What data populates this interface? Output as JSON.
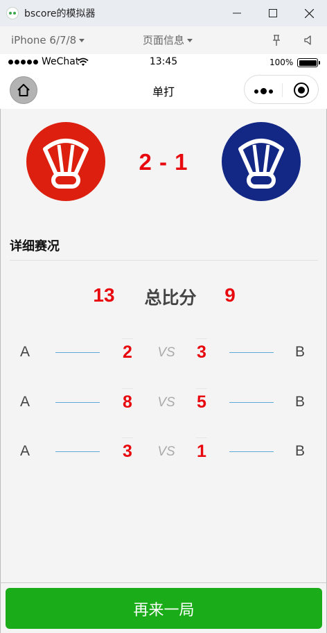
{
  "window": {
    "title": "bscore的模拟器"
  },
  "simulator": {
    "device": "iPhone 6/7/8",
    "page_info": "页面信息"
  },
  "status": {
    "carrier": "WeChat",
    "time": "13:45",
    "battery": "100%"
  },
  "nav": {
    "title": "单打"
  },
  "match": {
    "score": "2 - 1",
    "team_a_color": "#dc1f0e",
    "team_b_color": "#132785",
    "score_color": "#e8090f"
  },
  "details": {
    "title": "详细赛况",
    "total_label": "总比分",
    "total_a": "13",
    "total_b": "9",
    "vs_label": "VS",
    "sets": [
      {
        "player_a": "A",
        "score_a": "2",
        "score_b": "3",
        "player_b": "B"
      },
      {
        "player_a": "A",
        "score_a": "8",
        "score_b": "5",
        "player_b": "B"
      },
      {
        "player_a": "A",
        "score_a": "3",
        "score_b": "1",
        "player_b": "B"
      }
    ]
  },
  "footer": {
    "button_label": "再来一局",
    "button_color": "#1aad19"
  }
}
